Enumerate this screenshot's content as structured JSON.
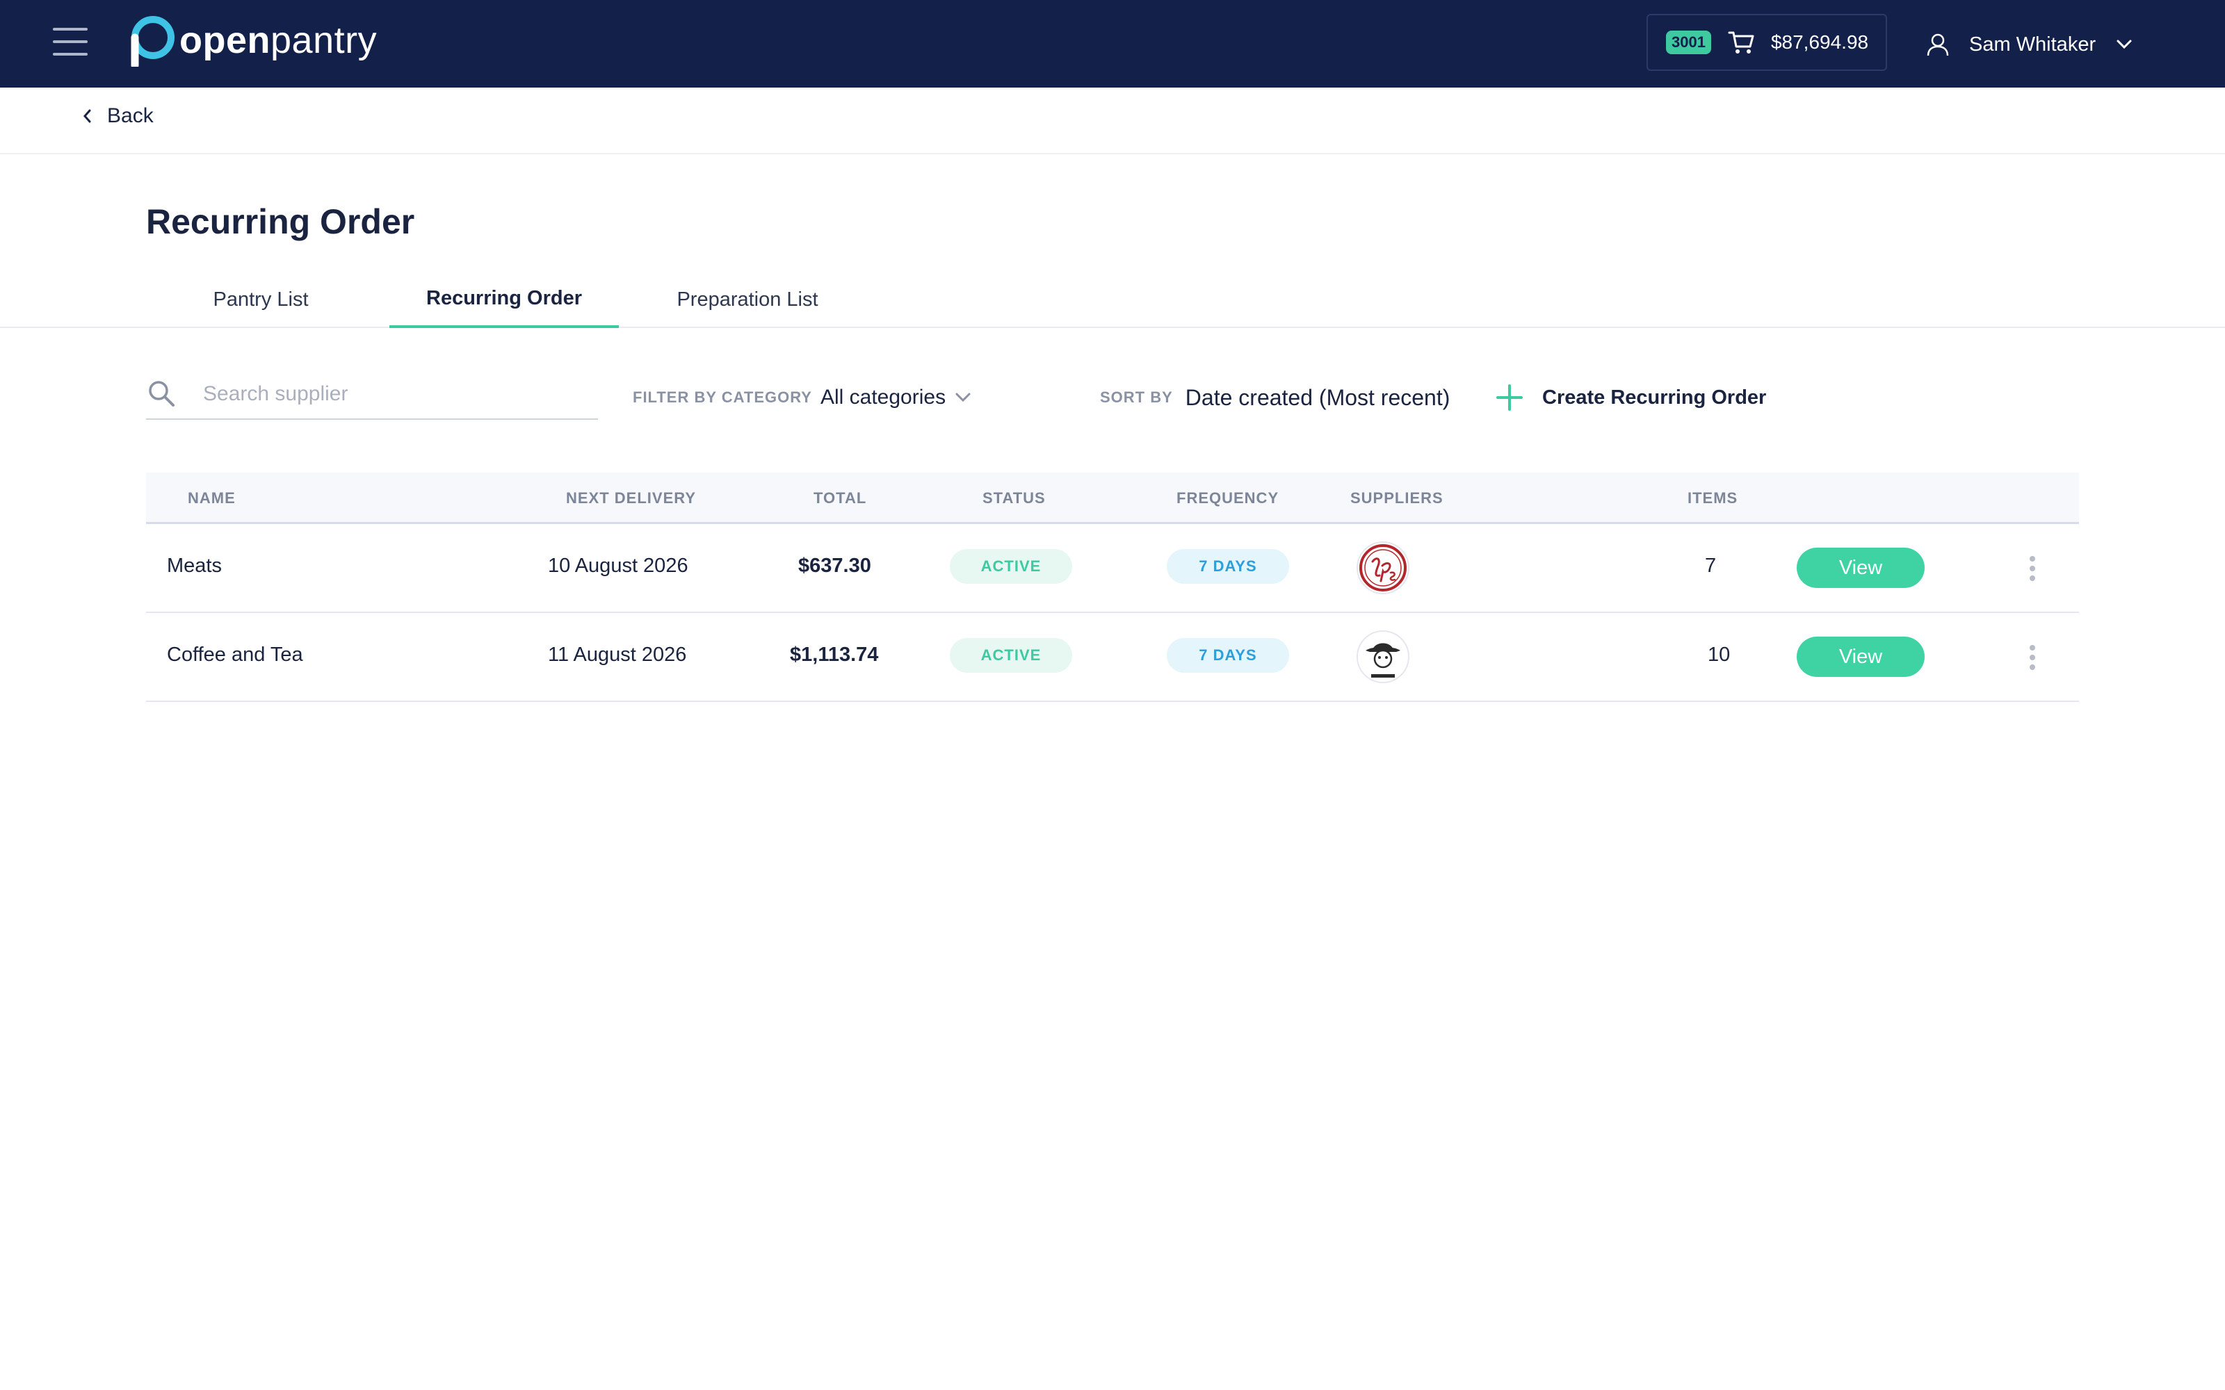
{
  "header": {
    "logo": {
      "word_bold": "open",
      "word_light": "pantry"
    },
    "cart": {
      "badge": "3001",
      "total": "$87,694.98",
      "icon": "cart-icon"
    },
    "user": {
      "name": "Sam Whitaker",
      "icon": "user-icon"
    },
    "menu_icon": "hamburger-icon"
  },
  "back": {
    "label": "Back"
  },
  "page_title": "Recurring Order",
  "tabs": [
    {
      "label": "Pantry List",
      "active": false
    },
    {
      "label": "Recurring Order",
      "active": true
    },
    {
      "label": "Preparation List",
      "active": false
    }
  ],
  "toolbar": {
    "search_placeholder": "Search supplier",
    "search_value": "",
    "filter_label": "FILTER BY CATEGORY",
    "filter_value": "All categories",
    "sort_label": "SORT BY",
    "sort_value": "Date created (Most recent)",
    "create_label": "Create Recurring Order"
  },
  "table": {
    "columns": [
      "NAME",
      "NEXT DELIVERY",
      "TOTAL",
      "STATUS",
      "FREQUENCY",
      "SUPPLIERS",
      "ITEMS"
    ],
    "rows": [
      {
        "name": "Meats",
        "next_delivery": "10 August 2026",
        "total": "$637.30",
        "status": "ACTIVE",
        "frequency": "7 DAYS",
        "supplier_logo": "lps-supplier-logo",
        "items": "7",
        "action": "View"
      },
      {
        "name": "Coffee and Tea",
        "next_delivery": "11 August 2026",
        "total": "$1,113.74",
        "status": "ACTIVE",
        "frequency": "7 DAYS",
        "supplier_logo": "coffee-supplier-logo",
        "items": "10",
        "action": "View"
      }
    ]
  },
  "colors": {
    "nav_bg": "#13204a",
    "accent": "#3fc9a0",
    "frequency": "#2d9ed9",
    "text": "#1a2340"
  }
}
